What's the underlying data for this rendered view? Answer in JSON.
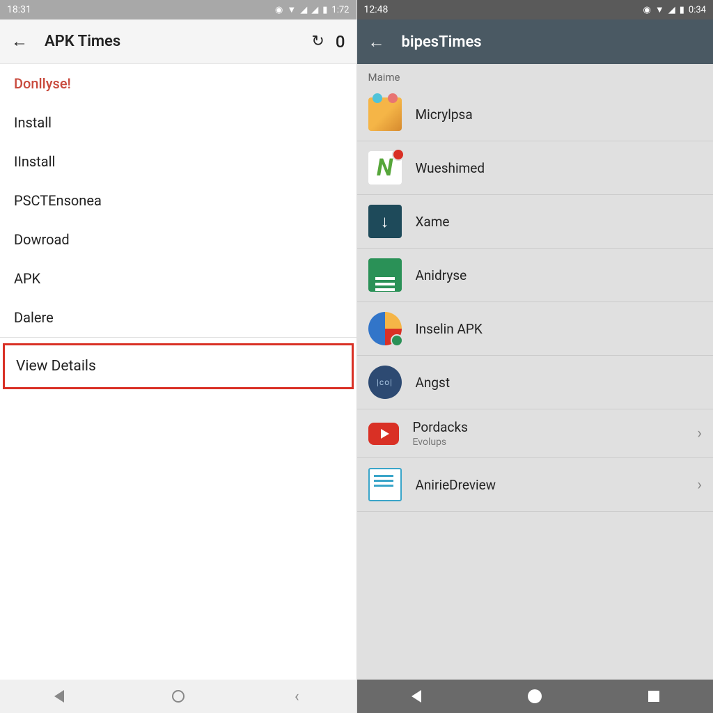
{
  "left": {
    "status": {
      "time": "18:31",
      "battery": "1:72"
    },
    "appbar": {
      "title": "APK Times",
      "count": "0"
    },
    "menu": [
      {
        "label": "Donllyse!",
        "highlight": true
      },
      {
        "label": "Install"
      },
      {
        "label": "IInstall"
      },
      {
        "label": "PSCTEnsonea"
      },
      {
        "label": "Dowroad"
      },
      {
        "label": "APK"
      },
      {
        "label": "Dalere"
      }
    ],
    "view_details": "View Details"
  },
  "right": {
    "status": {
      "time": "12:48",
      "battery": "0:34"
    },
    "appbar": {
      "title": "bipesTimes"
    },
    "section": "Maime",
    "apps": [
      {
        "name": "Micrylpsa",
        "icon": "mail"
      },
      {
        "name": "Wueshimed",
        "icon": "n"
      },
      {
        "name": "Xame",
        "icon": "down"
      },
      {
        "name": "Anidryse",
        "icon": "lines"
      },
      {
        "name": "Inselin APK",
        "icon": "pie"
      },
      {
        "name": "Angst",
        "icon": "circle"
      },
      {
        "name": "Pordacks",
        "sub": "Evolups",
        "icon": "yt",
        "chevron": true
      },
      {
        "name": "AnirieDreview",
        "icon": "doc",
        "chevron": true
      }
    ]
  }
}
